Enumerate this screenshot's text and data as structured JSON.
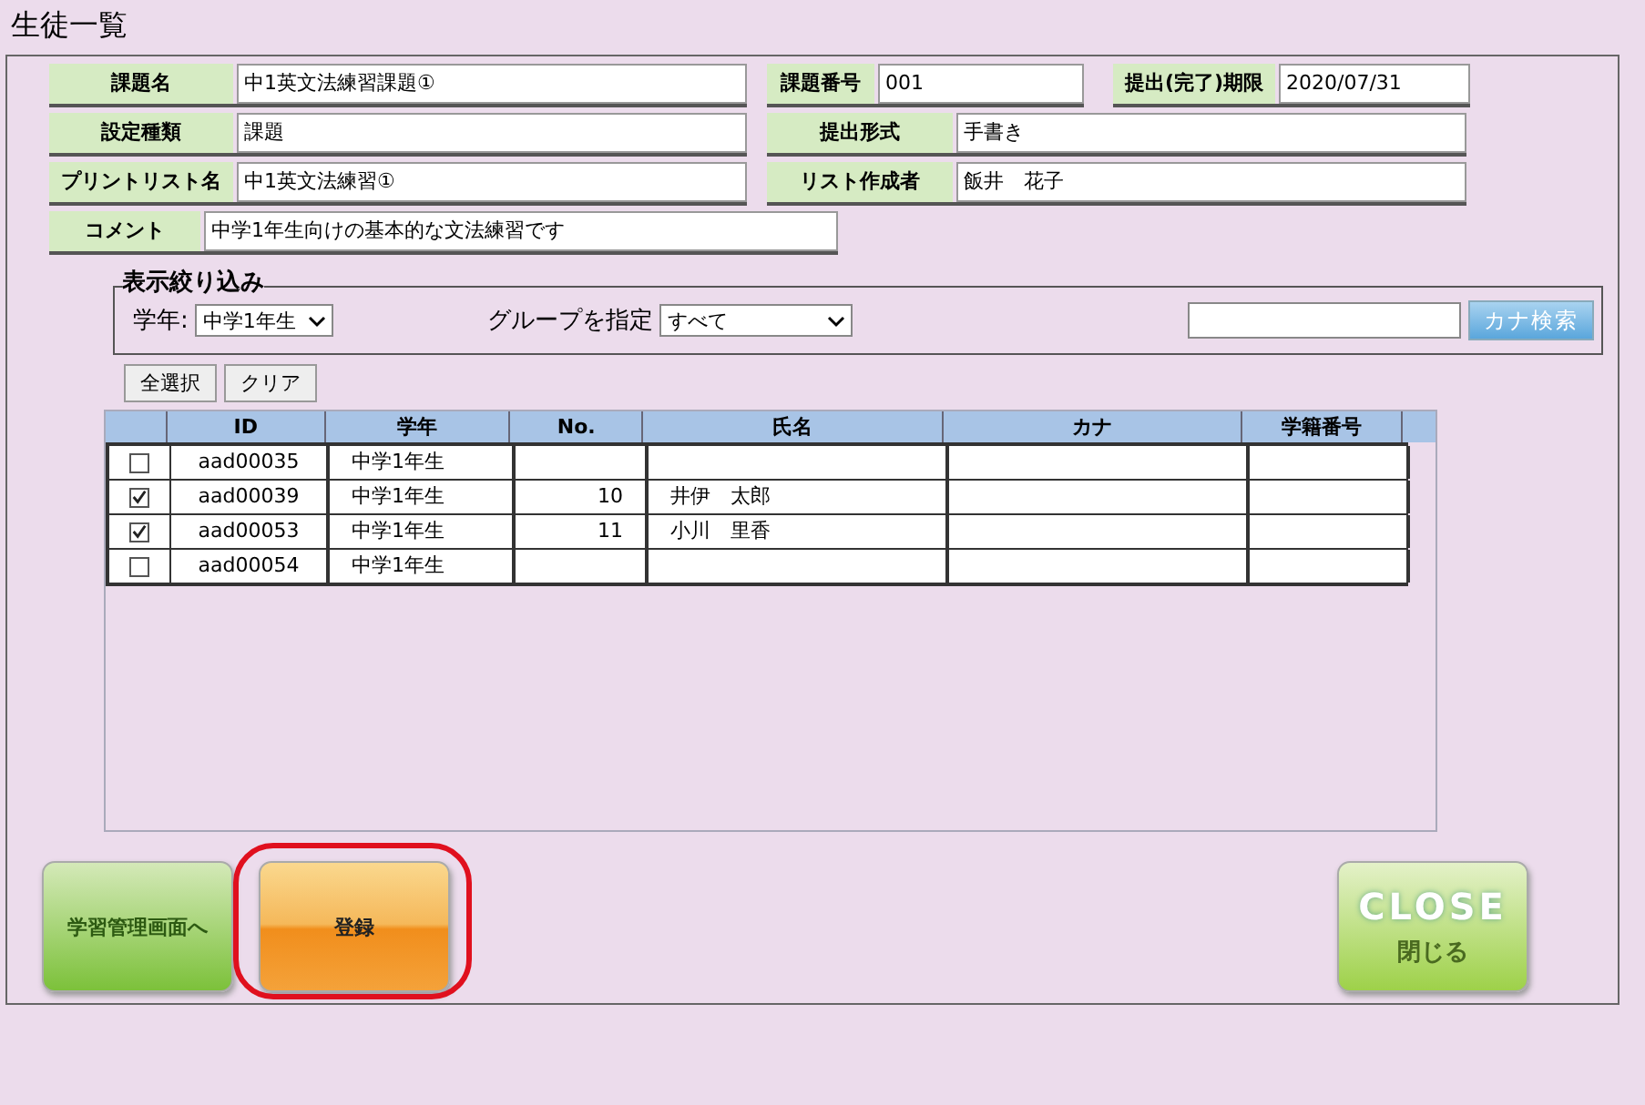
{
  "title": "生徒一覧",
  "fields": [
    [
      {
        "label": "課題名",
        "value": "中1英文法練習課題①"
      },
      {
        "label": "課題番号",
        "value": "001"
      },
      {
        "label": "提出(完了)期限",
        "value": "2020/07/31"
      }
    ],
    [
      {
        "label": "設定種類",
        "value": "課題"
      },
      {
        "label": "提出形式",
        "value": "手書き"
      }
    ],
    [
      {
        "label": "プリントリスト名",
        "value": "中1英文法練習①"
      },
      {
        "label": "リスト作成者",
        "value": "飯井　花子"
      }
    ],
    [
      {
        "label": "コメント",
        "value": "中学1年生向けの基本的な文法練習です"
      }
    ]
  ],
  "filter": {
    "legend": "表示絞り込み",
    "grade_label": "学年:",
    "grade_value": "中学1年生",
    "group_label": "グループを指定",
    "group_value": "すべて",
    "search_button": "カナ検索"
  },
  "select_buttons": [
    "全選択",
    "クリア"
  ],
  "table": {
    "columns": [
      "ID",
      "学年",
      "No.",
      "氏名",
      "カナ",
      "学籍番号"
    ],
    "rows": [
      {
        "checked": false,
        "cells": [
          "aad00035",
          "中学1年生",
          "",
          "",
          "",
          ""
        ]
      },
      {
        "checked": true,
        "cells": [
          "aad00039",
          "中学1年生",
          "10",
          "井伊　太郎",
          "",
          ""
        ]
      },
      {
        "checked": true,
        "cells": [
          "aad00053",
          "中学1年生",
          "11",
          "小川　里香",
          "",
          ""
        ]
      },
      {
        "checked": false,
        "cells": [
          "aad00054",
          "中学1年生",
          "",
          "",
          "",
          ""
        ]
      }
    ]
  },
  "actions": [
    {
      "kind": "green",
      "label": "学習管理画面へ",
      "highlighted": false
    },
    {
      "kind": "orange",
      "label": "登録",
      "highlighted": true
    },
    {
      "kind": "close",
      "label": "CLOSE",
      "sublabel": "閉じる"
    }
  ]
}
